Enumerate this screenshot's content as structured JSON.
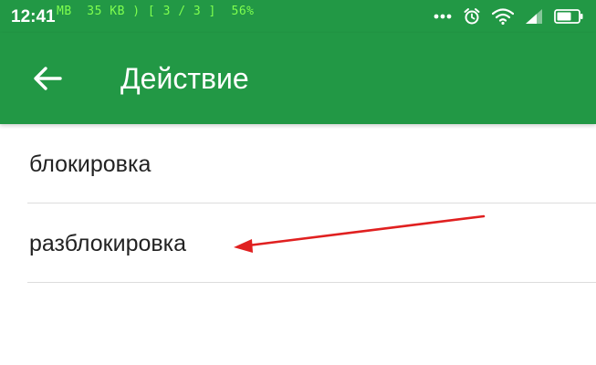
{
  "status_bar": {
    "time": "12:41",
    "overlay_text": "МВ  35 KB ) [ 3 / 3 ]  56%",
    "icons": [
      "more-dots-icon",
      "alarm-clock-icon",
      "wifi-icon",
      "signal-icon",
      "battery-icon"
    ]
  },
  "app_bar": {
    "title": "Действие",
    "back_icon": "arrow-left-icon",
    "background_color": "#229845"
  },
  "list": {
    "items": [
      {
        "label": "блокировка"
      },
      {
        "label": "разблокировка"
      }
    ]
  },
  "annotation": {
    "type": "arrow",
    "color": "#e02020",
    "points_to": "разблокировка"
  }
}
